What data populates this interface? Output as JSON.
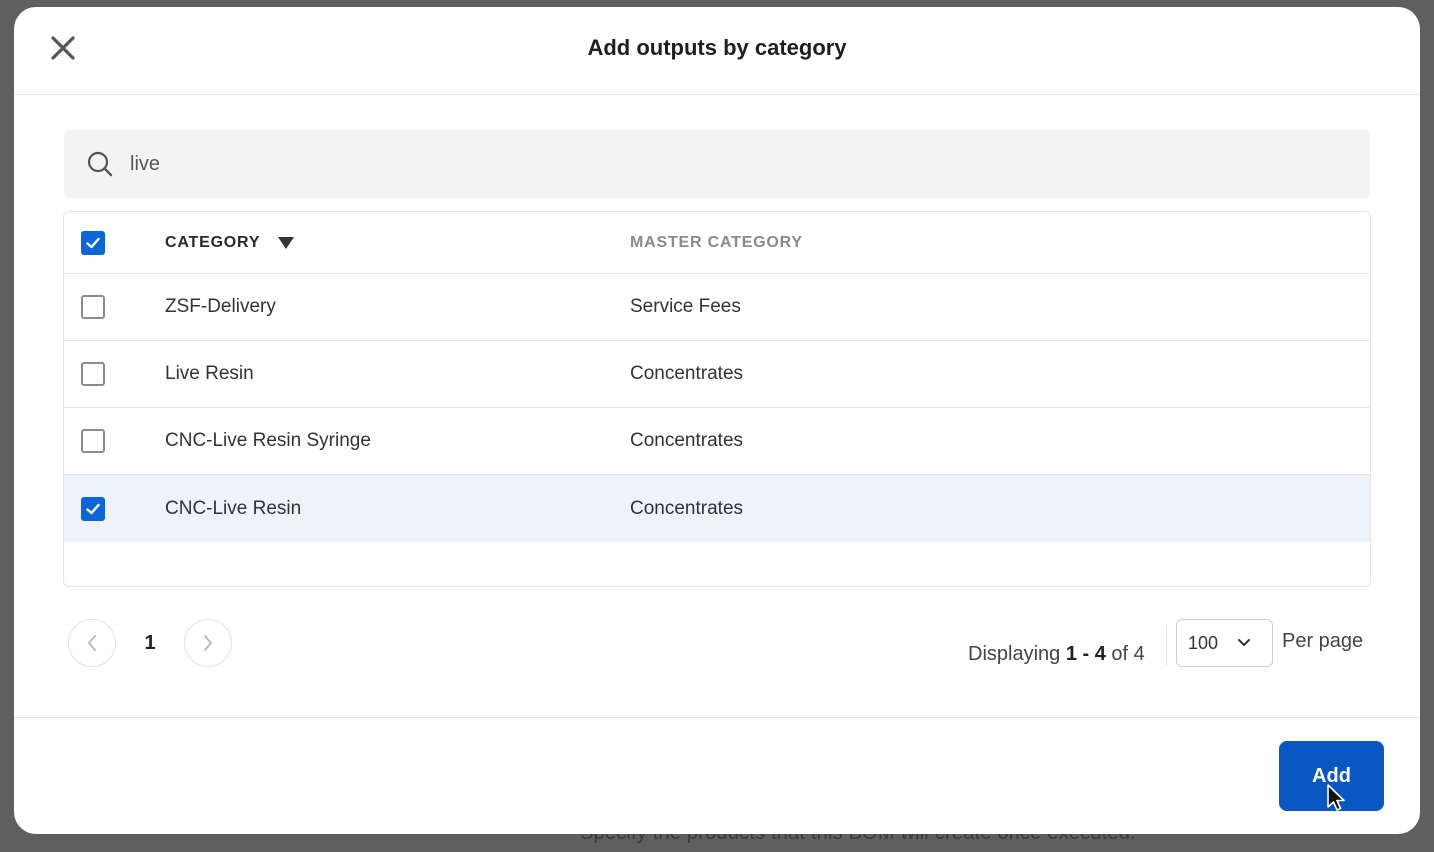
{
  "background": {
    "partial_text": "Specify the products that this BOM will create once executed."
  },
  "modal": {
    "title": "Add outputs by category",
    "close_icon": "close-icon"
  },
  "search": {
    "value": "live",
    "icon": "search-icon"
  },
  "table": {
    "header_checked": true,
    "columns": {
      "category": "CATEGORY",
      "master_category": "MASTER CATEGORY"
    },
    "sort_icon": "caret-down-icon",
    "rows": [
      {
        "category": "ZSF-Delivery",
        "master_category": "Service Fees",
        "checked": false
      },
      {
        "category": "Live Resin",
        "master_category": "Concentrates",
        "checked": false
      },
      {
        "category": "CNC-Live Resin Syringe",
        "master_category": "Concentrates",
        "checked": false
      },
      {
        "category": "CNC-Live Resin",
        "master_category": "Concentrates",
        "checked": true
      }
    ]
  },
  "pagination": {
    "current_page": "1",
    "display_prefix": "Displaying",
    "range": "1 - 4",
    "of_label": "of",
    "total": "4",
    "per_page_value": "100",
    "per_page_label": "Per page"
  },
  "footer": {
    "add_label": "Add"
  },
  "colors": {
    "accent": "#0a56c2",
    "checkbox": "#0a66d6",
    "selected_row": "#eef2fb"
  }
}
